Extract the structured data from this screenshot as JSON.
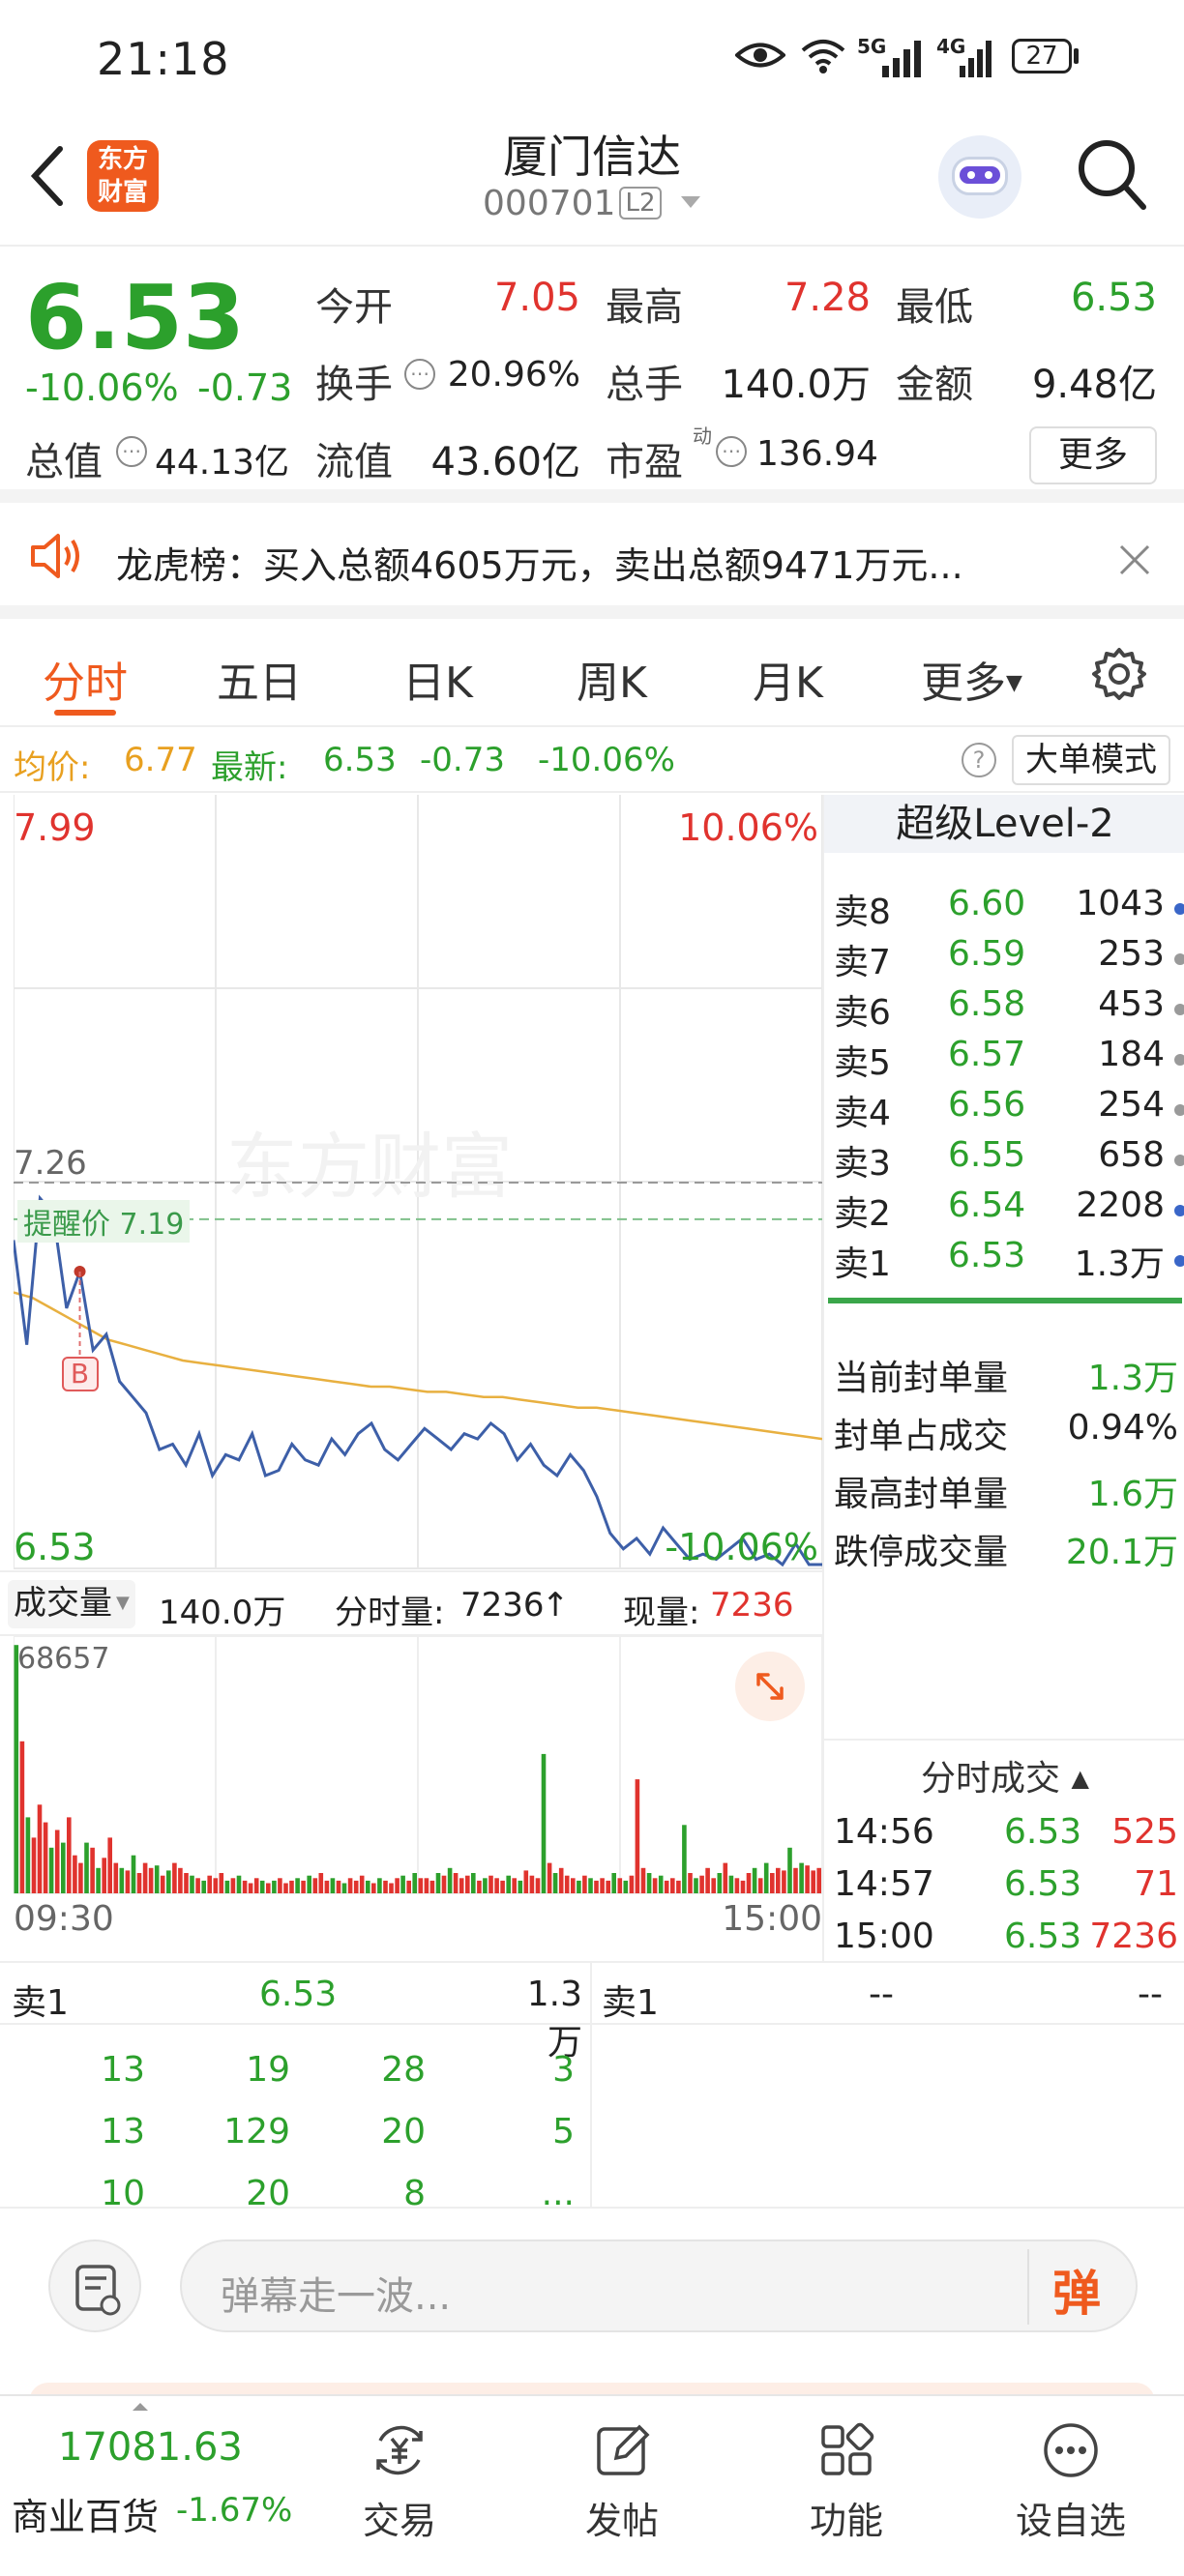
{
  "status_bar": {
    "time": "21:18",
    "network_5g": "5G",
    "network_4g": "4G",
    "battery": "27"
  },
  "header": {
    "logo_text": "东方财富",
    "stock_name": "厦门信达",
    "stock_code": "000701",
    "level_badge": "L2"
  },
  "quote": {
    "price": "6.53",
    "change_pct": "-10.06%",
    "change": "-0.73",
    "open_label": "今开",
    "open": "7.05",
    "high_label": "最高",
    "high": "7.28",
    "low_label": "最低",
    "low": "6.53",
    "turnover_label": "换手",
    "turnover": "20.96%",
    "volume_label": "总手",
    "volume": "140.0万",
    "amount_label": "金额",
    "amount": "9.48亿",
    "mktcap_label": "总值",
    "mktcap": "44.13亿",
    "float_label": "流值",
    "float_cap": "43.60亿",
    "pe_label": "市盈",
    "pe_sup": "动",
    "pe": "136.94",
    "more_button": "更多"
  },
  "news": {
    "text": "龙虎榜：买入总额4605万元，卖出总额9471万元..."
  },
  "tabs": [
    "分时",
    "五日",
    "日K",
    "周K",
    "月K",
    "更多"
  ],
  "avg_line": {
    "avg_label": "均价:",
    "avg": "6.77",
    "latest_label": "最新:",
    "latest": "6.53",
    "change": "-0.73",
    "change_pct": "-10.06%",
    "big_order_mode": "大单模式"
  },
  "chart_data": {
    "type": "line",
    "price_top": "7.99",
    "price_bottom": "6.53",
    "pct_top": "10.06%",
    "pct_bottom": "-10.06%",
    "ref_label": "7.26",
    "alert_label": "提醒价 7.19",
    "watermark": "东方财富",
    "marker": "B",
    "ylim": [
      6.53,
      7.99
    ],
    "ref_price": 7.26,
    "alert_price": 7.19,
    "price_series": [
      7.15,
      6.95,
      7.23,
      7.2,
      7.02,
      7.09,
      6.94,
      6.97,
      6.88,
      6.85,
      6.82,
      6.75,
      6.76,
      6.72,
      6.78,
      6.7,
      6.74,
      6.73,
      6.78,
      6.7,
      6.71,
      6.76,
      6.73,
      6.72,
      6.77,
      6.74,
      6.78,
      6.8,
      6.75,
      6.73,
      6.76,
      6.79,
      6.77,
      6.75,
      6.78,
      6.77,
      6.8,
      6.78,
      6.73,
      6.76,
      6.72,
      6.7,
      6.74,
      6.71,
      6.66,
      6.59,
      6.56,
      6.58,
      6.55,
      6.6,
      6.57,
      6.54,
      6.55,
      6.54,
      6.56,
      6.58,
      6.54,
      6.55,
      6.53,
      6.57,
      6.53,
      6.53
    ],
    "avg_series": [
      7.05,
      7.04,
      7.02,
      7.0,
      6.98,
      6.96,
      6.95,
      6.94,
      6.93,
      6.92,
      6.915,
      6.91,
      6.905,
      6.9,
      6.895,
      6.89,
      6.885,
      6.88,
      6.875,
      6.87,
      6.87,
      6.865,
      6.86,
      6.86,
      6.855,
      6.85,
      6.85,
      6.845,
      6.84,
      6.835,
      6.83,
      6.83,
      6.825,
      6.82,
      6.815,
      6.81,
      6.805,
      6.8,
      6.795,
      6.79,
      6.785,
      6.78,
      6.775,
      6.77
    ],
    "volume_label": "成交量",
    "volume_total": "140.0万",
    "tick_volume_label": "分时量:",
    "tick_volume": "7236",
    "current_volume_label": "现量:",
    "current_volume": "7236",
    "volume_max_label": "68657",
    "time_start": "09:30",
    "time_end": "15:00",
    "volume_bars": [
      0.98,
      0.6,
      0.3,
      0.22,
      0.35,
      0.28,
      0.18,
      0.25,
      0.2,
      0.3,
      0.15,
      0.12,
      0.2,
      0.18,
      0.1,
      0.14,
      0.22,
      0.12,
      0.1,
      0.09,
      0.15,
      0.08,
      0.12,
      0.1,
      0.11,
      0.07,
      0.09,
      0.12,
      0.1,
      0.08,
      0.07,
      0.06,
      0.05,
      0.07,
      0.06,
      0.08,
      0.05,
      0.06,
      0.07,
      0.05,
      0.04,
      0.06,
      0.05,
      0.04,
      0.05,
      0.06,
      0.04,
      0.05,
      0.06,
      0.05,
      0.07,
      0.06,
      0.08,
      0.05,
      0.06,
      0.05,
      0.04,
      0.06,
      0.05,
      0.07,
      0.05,
      0.04,
      0.06,
      0.05,
      0.04,
      0.06,
      0.07,
      0.05,
      0.08,
      0.06,
      0.06,
      0.05,
      0.08,
      0.07,
      0.1,
      0.08,
      0.06,
      0.07,
      0.08,
      0.05,
      0.06,
      0.07,
      0.06,
      0.05,
      0.07,
      0.06,
      0.05,
      0.09,
      0.07,
      0.06,
      0.55,
      0.12,
      0.08,
      0.1,
      0.07,
      0.06,
      0.05,
      0.07,
      0.06,
      0.05,
      0.06,
      0.05,
      0.08,
      0.06,
      0.05,
      0.07,
      0.45,
      0.1,
      0.08,
      0.06,
      0.07,
      0.05,
      0.06,
      0.05,
      0.27,
      0.08,
      0.06,
      0.07,
      0.1,
      0.06,
      0.08,
      0.12,
      0.07,
      0.06,
      0.05,
      0.08,
      0.1,
      0.06,
      0.12,
      0.08,
      0.1,
      0.09,
      0.18,
      0.1,
      0.12,
      0.11,
      0.09,
      0.1
    ]
  },
  "level2": {
    "title": "超级Level-2",
    "asks": [
      {
        "label": "卖8",
        "price": "6.60",
        "vol": "1043",
        "dot": "#3a66c8"
      },
      {
        "label": "卖7",
        "price": "6.59",
        "vol": "253",
        "dot": "#9a9a9a"
      },
      {
        "label": "卖6",
        "price": "6.58",
        "vol": "453",
        "dot": "#9a9a9a"
      },
      {
        "label": "卖5",
        "price": "6.57",
        "vol": "184",
        "dot": "#9a9a9a"
      },
      {
        "label": "卖4",
        "price": "6.56",
        "vol": "254",
        "dot": "#9a9a9a"
      },
      {
        "label": "卖3",
        "price": "6.55",
        "vol": "658",
        "dot": "#9a9a9a"
      },
      {
        "label": "卖2",
        "price": "6.54",
        "vol": "2208",
        "dot": "#3a66c8"
      },
      {
        "label": "卖1",
        "price": "6.53",
        "vol": "1.3万",
        "dot": "#3a66c8"
      }
    ],
    "stats": [
      {
        "label": "当前封单量",
        "value": "1.3万"
      },
      {
        "label": "封单占成交",
        "value": "0.94%"
      },
      {
        "label": "最高封单量",
        "value": "1.6万"
      },
      {
        "label": "跌停成交量",
        "value": "20.1万"
      }
    ],
    "trades_title": "分时成交",
    "trades": [
      {
        "time": "14:56",
        "price": "6.53",
        "vol": "525"
      },
      {
        "time": "14:57",
        "price": "6.53",
        "vol": "71"
      },
      {
        "time": "15:00",
        "price": "6.53",
        "vol": "7236"
      }
    ]
  },
  "queue": {
    "left_label": "卖1",
    "left_price": "6.53",
    "left_vol": "1.3万",
    "right_label": "卖1",
    "right_price": "--",
    "right_vol": "--",
    "rows": [
      [
        "13",
        "19",
        "28",
        "3"
      ],
      [
        "13",
        "129",
        "20",
        "5"
      ],
      [
        "10",
        "20",
        "8",
        "..."
      ]
    ]
  },
  "comment": {
    "placeholder": "弹幕走一波...",
    "danmu_button": "弹"
  },
  "bottom_nav": {
    "index_value": "17081.63",
    "index_name": "商业百货",
    "index_change": "-1.67%",
    "items": [
      "交易",
      "发帖",
      "功能",
      "设自选"
    ]
  },
  "colors": {
    "up": "#e0332e",
    "down": "#2ca02c",
    "accent": "#ef5a1e",
    "avg_line": "#e8b040",
    "price_line": "#3d5fa8"
  }
}
